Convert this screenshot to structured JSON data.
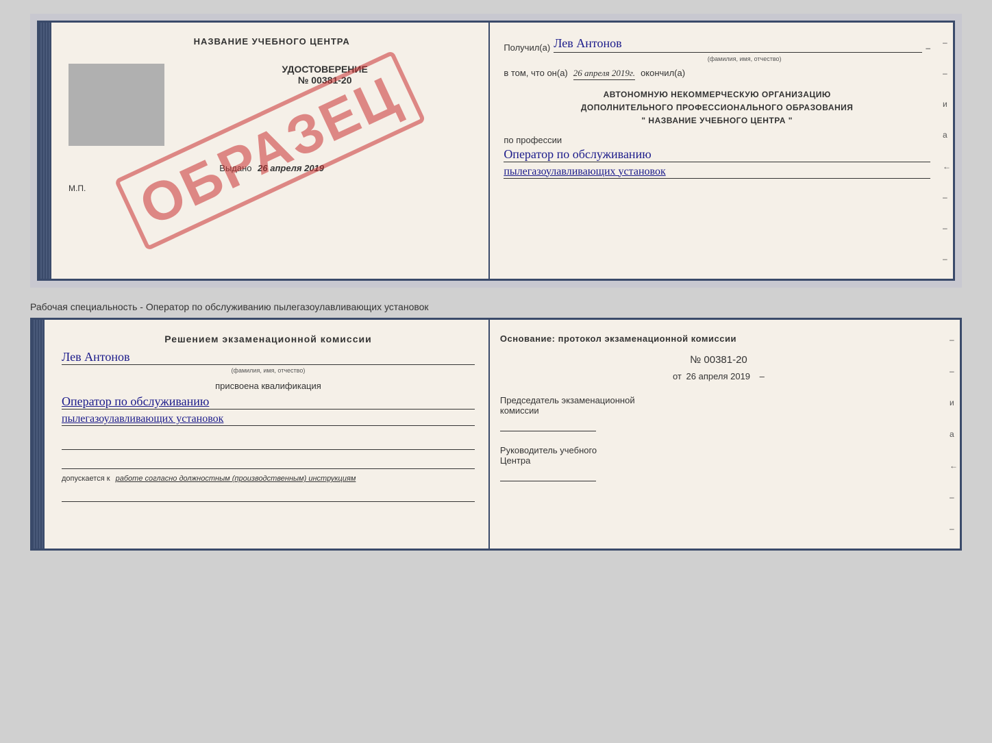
{
  "page": {
    "background_color": "#d0d0d0"
  },
  "top_certificate": {
    "left": {
      "training_center_label": "НАЗВАНИЕ УЧЕБНОГО ЦЕНТРА",
      "document_type": "УДОСТОВЕРЕНИЕ",
      "doc_number": "№ 00381-20",
      "vydano_label": "Выдано",
      "vydano_date": "26 апреля 2019",
      "mp_label": "М.П.",
      "obrazec_watermark": "ОБРАЗЕЦ"
    },
    "right": {
      "poluchil_prefix": "Получил(а)",
      "recipient_name": "Лев Антонов",
      "fio_label": "(фамилия, имя, отчество)",
      "vtom_prefix": "в том, что он(а)",
      "completion_date": "26 апреля 2019г.",
      "okonchil_label": "окончил(а)",
      "org_line1": "АВТОНОМНУЮ НЕКОММЕРЧЕСКУЮ ОРГАНИЗАЦИЮ",
      "org_line2": "ДОПОЛНИТЕЛЬНОГО ПРОФЕССИОНАЛЬНОГО ОБРАЗОВАНИЯ",
      "org_line3": "\"  НАЗВАНИЕ УЧЕБНОГО ЦЕНТРА  \"",
      "po_professii_label": "по профессии",
      "profession_line1": "Оператор по обслуживанию",
      "profession_line2": "пылегазоулавливающих установок"
    }
  },
  "middle_label": {
    "text": "Рабочая специальность - Оператор по обслуживанию пылегазоулавливающих установок"
  },
  "bottom_certificate": {
    "left": {
      "resheniem_label": "Решением экзаменационной комиссии",
      "recipient_name": "Лев Антонов",
      "fio_label": "(фамилия, имя, отчество)",
      "prisvoena_label": "присвоена квалификация",
      "qualification_line1": "Оператор по обслуживанию",
      "qualification_line2": "пылегазоулавливающих установок",
      "dopuskaetsya_prefix": "допускается к",
      "dopuskaetsya_text": "работе согласно должностным (производственным) инструкциям"
    },
    "right": {
      "osnovanie_label": "Основание: протокол экзаменационной комиссии",
      "protocol_number": "№ 00381-20",
      "protocol_date_prefix": "от",
      "protocol_date": "26 апреля 2019",
      "predsedatel_line1": "Председатель экзаменационной",
      "predsedatel_line2": "комиссии",
      "rukovoditel_line1": "Руководитель учебного",
      "rukovoditel_line2": "Центра"
    }
  },
  "side_annotations": {
    "items": [
      "и",
      "а",
      "←",
      "–",
      "–",
      "–",
      "–"
    ]
  }
}
